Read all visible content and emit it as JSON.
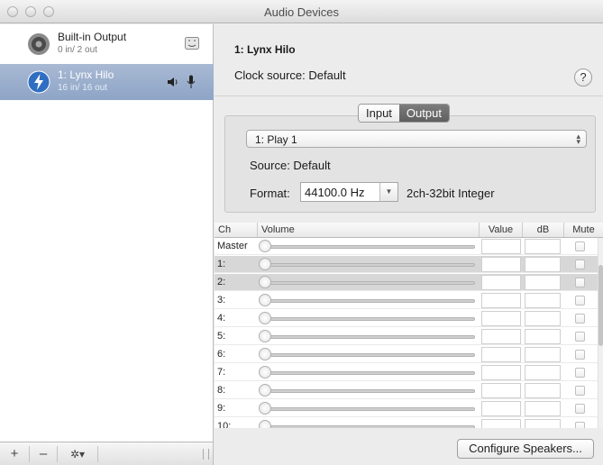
{
  "window": {
    "title": "Audio Devices"
  },
  "sidebar": {
    "devices": [
      {
        "name": "Built-in Output",
        "channels": "0 in/ 2 out",
        "icon": "speaker-icon",
        "selected": false
      },
      {
        "name": "1: Lynx Hilo",
        "channels": "16 in/ 16 out",
        "icon": "thunderbolt-icon",
        "selected": true
      }
    ],
    "add_label": "+",
    "remove_label": "–",
    "gear_label": "✲▾"
  },
  "device_panel": {
    "title": "1: Lynx Hilo",
    "clock_source": "Clock source: Default",
    "help_label": "?",
    "tabs": [
      {
        "label": "Input",
        "active": false
      },
      {
        "label": "Output",
        "active": true
      }
    ],
    "stream": "1: Play 1",
    "source": "Source: Default",
    "format_label": "Format:",
    "format_value": "44100.0 Hz",
    "format_extra": "2ch-32bit Integer"
  },
  "channel_table": {
    "columns": [
      "Ch",
      "Volume",
      "Value",
      "dB",
      "Mute"
    ],
    "rows": [
      {
        "ch": "Master",
        "selected": false
      },
      {
        "ch": "1:",
        "selected": true
      },
      {
        "ch": "2:",
        "selected": true
      },
      {
        "ch": "3:",
        "selected": false
      },
      {
        "ch": "4:",
        "selected": false
      },
      {
        "ch": "5:",
        "selected": false
      },
      {
        "ch": "6:",
        "selected": false
      },
      {
        "ch": "7:",
        "selected": false
      },
      {
        "ch": "8:",
        "selected": false
      },
      {
        "ch": "9:",
        "selected": false
      },
      {
        "ch": "10:",
        "selected": false
      }
    ]
  },
  "configure_button": "Configure Speakers..."
}
